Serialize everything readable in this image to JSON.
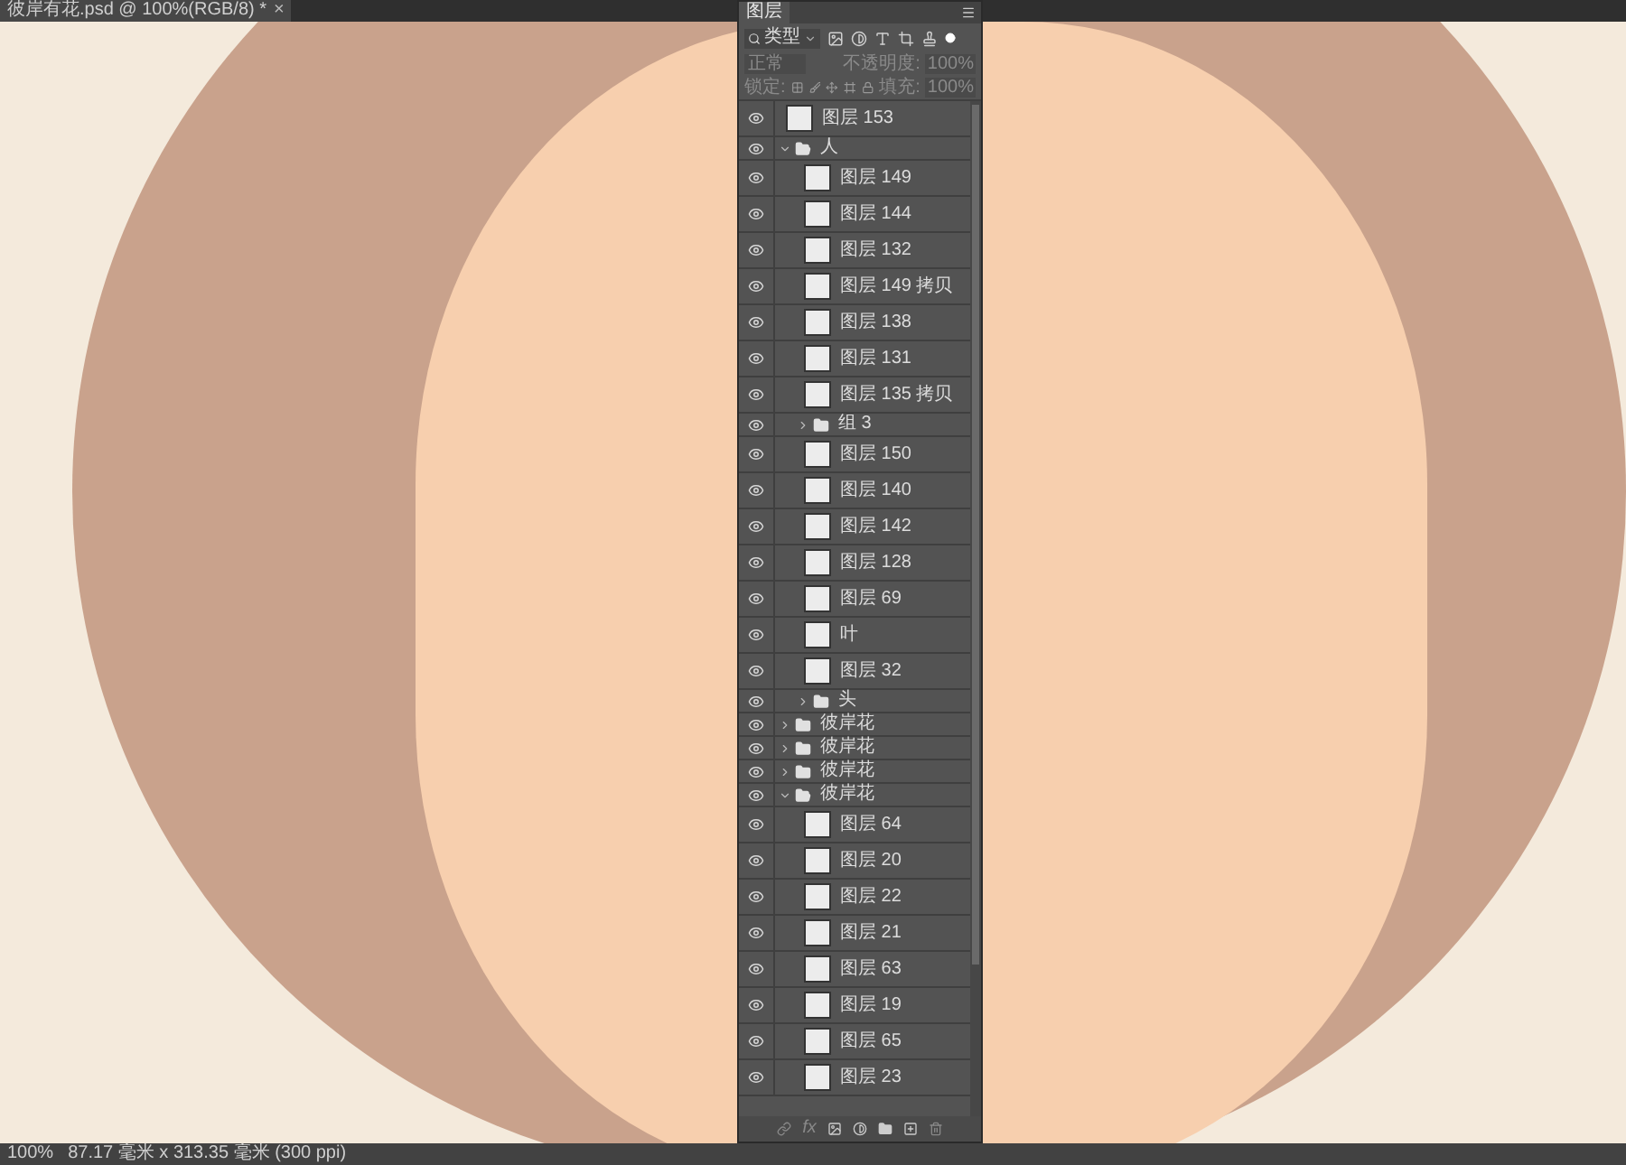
{
  "document_tab": {
    "title": "彼岸有花.psd @ 100%(RGB/8) *",
    "close": "×"
  },
  "layers_panel": {
    "tab": "图层",
    "filter": {
      "value": "类型"
    },
    "blend": {
      "mode": "正常",
      "opacity_label": "不透明度:",
      "opacity": "100%"
    },
    "lock": {
      "label": "锁定:",
      "fill_label": "填充:",
      "fill": "100%"
    },
    "layers": [
      {
        "kind": "layer",
        "name": "图层 153"
      },
      {
        "kind": "group",
        "name": "人",
        "expanded": true,
        "children": [
          {
            "kind": "layer",
            "name": "图层 149"
          },
          {
            "kind": "layer",
            "name": "图层 144"
          },
          {
            "kind": "layer",
            "name": "图层 132"
          },
          {
            "kind": "layer",
            "name": "图层 149 拷贝"
          },
          {
            "kind": "layer",
            "name": "图层 138"
          },
          {
            "kind": "layer",
            "name": "图层 131"
          },
          {
            "kind": "layer",
            "name": "图层 135 拷贝"
          },
          {
            "kind": "group",
            "name": "组 3",
            "expanded": false
          },
          {
            "kind": "layer",
            "name": "图层 150"
          },
          {
            "kind": "layer",
            "name": "图层 140"
          },
          {
            "kind": "layer",
            "name": "图层 142"
          },
          {
            "kind": "layer",
            "name": "图层 128"
          },
          {
            "kind": "layer",
            "name": "图层 69"
          },
          {
            "kind": "layer",
            "name": "叶"
          },
          {
            "kind": "layer",
            "name": "图层 32"
          },
          {
            "kind": "group",
            "name": "头",
            "expanded": false
          }
        ]
      },
      {
        "kind": "group",
        "name": "彼岸花",
        "expanded": false
      },
      {
        "kind": "group",
        "name": "彼岸花",
        "expanded": false
      },
      {
        "kind": "group",
        "name": "彼岸花",
        "expanded": false
      },
      {
        "kind": "group",
        "name": "彼岸花",
        "expanded": true,
        "children": [
          {
            "kind": "layer",
            "name": "图层 64"
          },
          {
            "kind": "layer",
            "name": "图层 20"
          },
          {
            "kind": "layer",
            "name": "图层 22"
          },
          {
            "kind": "layer",
            "name": "图层 21"
          },
          {
            "kind": "layer",
            "name": "图层 63"
          },
          {
            "kind": "layer",
            "name": "图层 19"
          },
          {
            "kind": "layer",
            "name": "图层 65"
          },
          {
            "kind": "layer",
            "name": "图层 23"
          }
        ]
      }
    ],
    "footer": {
      "fx": "fx"
    }
  },
  "status_bar": {
    "zoom": "100%",
    "size": "87.17 毫米 x 313.35 毫米 (300 ppi)"
  }
}
